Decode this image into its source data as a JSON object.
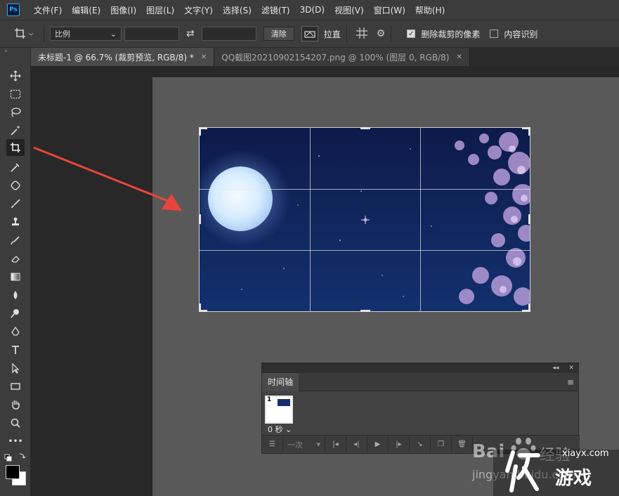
{
  "app": {
    "logo": "Ps"
  },
  "menubar": {
    "items": [
      "文件(F)",
      "编辑(E)",
      "图像(I)",
      "图层(L)",
      "文字(Y)",
      "选择(S)",
      "滤镜(T)",
      "3D(D)",
      "视图(V)",
      "窗口(W)",
      "帮助(H)"
    ]
  },
  "options": {
    "ratio_label": "比例",
    "clear_label": "清除",
    "straighten_label": "拉直",
    "delete_cropped_label": "删除裁剪的像素",
    "delete_cropped_checked": true,
    "content_aware_label": "内容识别",
    "content_aware_checked": false
  },
  "tabs": [
    {
      "label": "未标题-1 @ 66.7% (裁剪预览, RGB/8) *",
      "active": true
    },
    {
      "label": "QQ截图20210902154207.png @ 100% (图层 0, RGB/8)",
      "active": false
    }
  ],
  "timeline": {
    "title": "时间轴",
    "frame_number": "1",
    "frame_delay": "0 秒",
    "loop_label": "一次"
  },
  "watermark": {
    "baidu": "Bai",
    "jingyan": "经验",
    "jingyan_url": "jingyan.baidu.com",
    "site": "xiayx.com",
    "site_name": "游戏"
  },
  "colors": {
    "menubar_bg": "#3c3c3c",
    "canvas_bg": "#595959",
    "workspace_bg": "#282828",
    "arrow": "#e8453c",
    "accent": "#31a8ff"
  },
  "icons": {
    "toolbar": [
      "move-icon",
      "marquee-icon",
      "lasso-icon",
      "magic-wand-icon",
      "crop-icon",
      "eyedropper-icon",
      "healing-brush-icon",
      "brush-icon",
      "clone-stamp-icon",
      "history-brush-icon",
      "eraser-icon",
      "gradient-icon",
      "blur-icon",
      "dodge-icon",
      "pen-icon",
      "type-icon",
      "path-select-icon",
      "rectangle-icon",
      "hand-icon",
      "zoom-icon",
      "more-icon"
    ]
  }
}
